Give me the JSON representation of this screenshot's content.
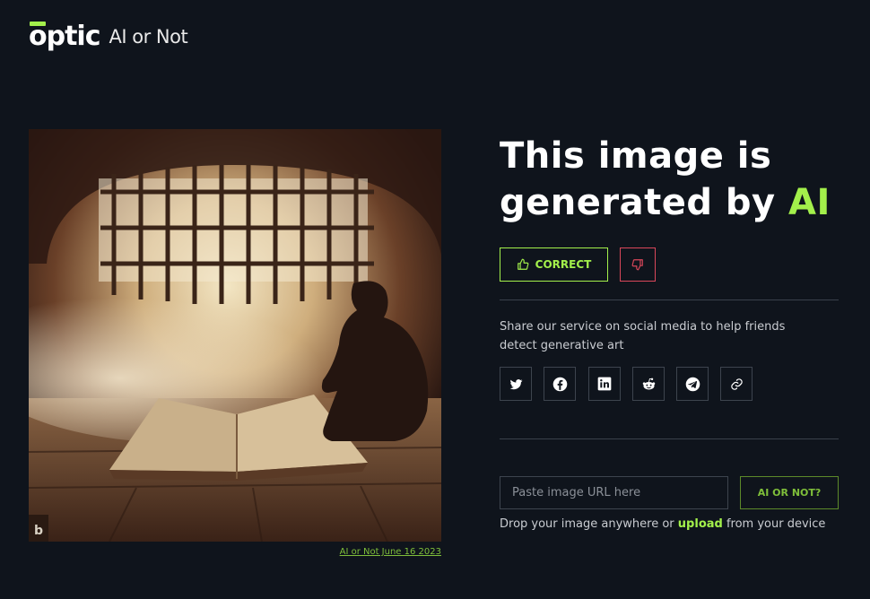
{
  "brand": {
    "logo_text": "optic",
    "product": "AI or Not",
    "accent": "#a3f04b"
  },
  "result": {
    "headline_prefix": "This image is generated by",
    "headline_highlight": "AI",
    "correct_label": "CORRECT"
  },
  "image": {
    "caption": "AI or Not June 16 2023",
    "watermark": "b"
  },
  "share": {
    "text": "Share our service on social media to help friends detect generative art",
    "icons": [
      "twitter-icon",
      "facebook-icon",
      "linkedin-icon",
      "reddit-icon",
      "telegram-icon",
      "link-icon"
    ]
  },
  "check": {
    "placeholder": "Paste image URL here",
    "button_label": "AI OR NOT?",
    "drop_prefix": "Drop your image anywhere or",
    "upload_label": "upload",
    "drop_suffix": "from your device"
  }
}
